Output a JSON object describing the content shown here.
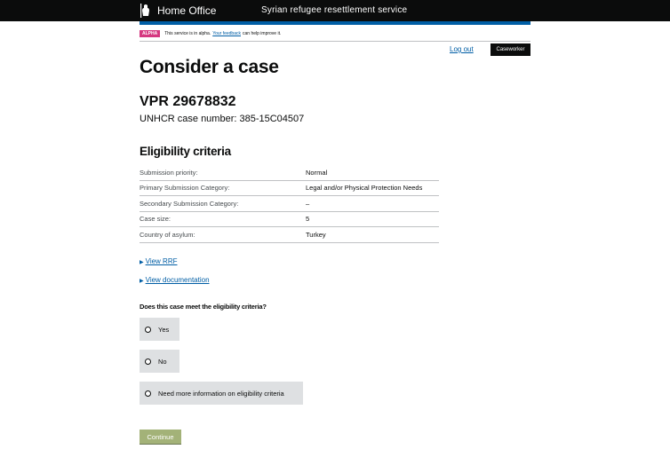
{
  "header": {
    "brand": "Home Office",
    "service_name": "Syrian refugee resettlement service"
  },
  "phase_banner": {
    "tag": "ALPHA",
    "text_before": "This service is in alpha.",
    "link": "Your feedback",
    "text_after": "can help improve it."
  },
  "user": {
    "logout_label": "Log out",
    "role": "Caseworker"
  },
  "page": {
    "title": "Consider a case",
    "case_ref": "VPR 29678832",
    "unhcr_case": "UNHCR case number: 385-15C04507"
  },
  "eligibility": {
    "title": "Eligibility criteria",
    "rows": [
      {
        "key": "Submission priority:",
        "value": "Normal"
      },
      {
        "key": "Primary Submission Category:",
        "value": "Legal and/or Physical Protection Needs"
      },
      {
        "key": "Secondary Submission Category:",
        "value": "–"
      },
      {
        "key": "Case size:",
        "value": "5"
      },
      {
        "key": "Country of asylum:",
        "value": "Turkey"
      }
    ]
  },
  "details": {
    "rrf": "View RRF",
    "documentation": "View documentation"
  },
  "question": {
    "label": "Does this case meet the eligibility criteria?",
    "options": [
      "Yes",
      "No",
      "Need more information on eligibility criteria"
    ]
  },
  "actions": {
    "continue": "Continue"
  },
  "colors": {
    "header_bg": "#0b0c0c",
    "blue_bar": "#005ea5",
    "alpha_tag": "#d53880",
    "link": "#005ea5",
    "radio_bg": "#dee0e2",
    "continue_bg": "#85994b"
  }
}
